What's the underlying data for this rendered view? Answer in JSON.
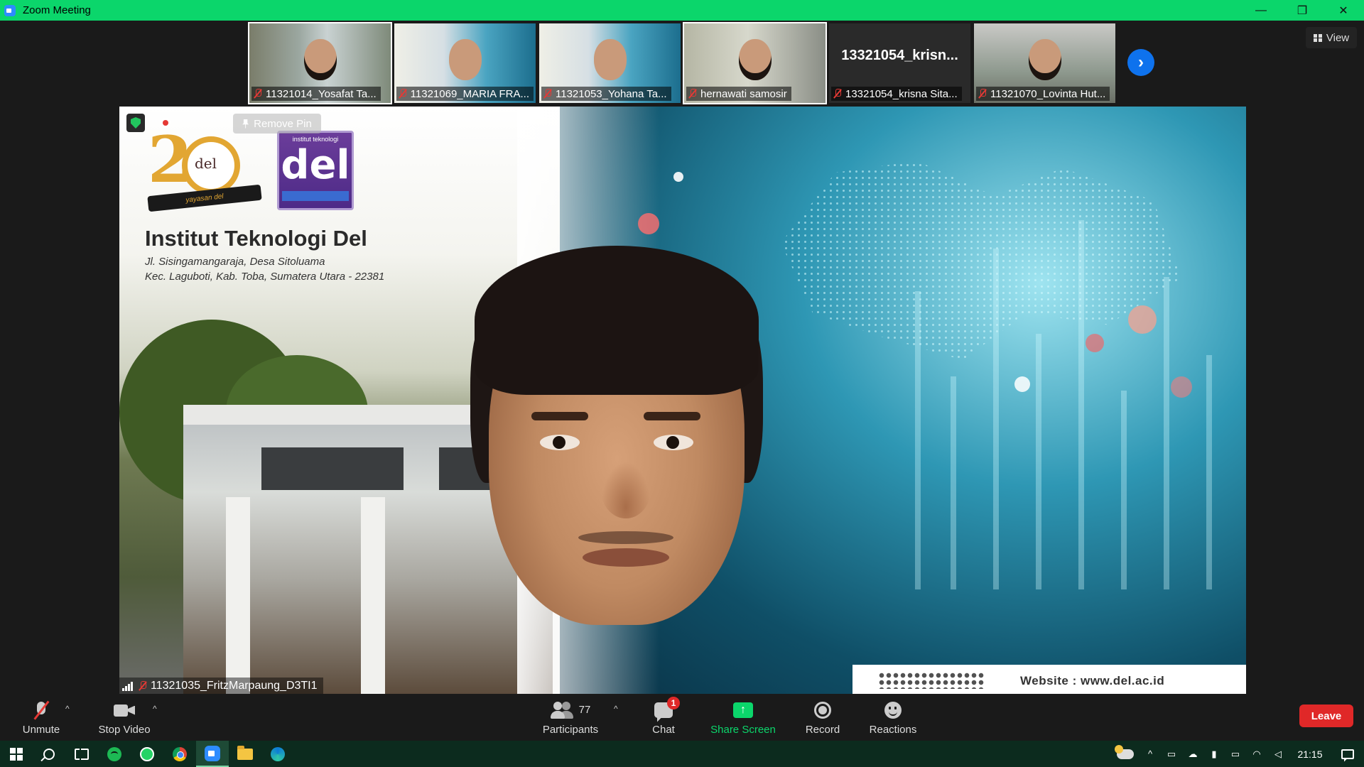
{
  "window": {
    "title": "Zoom Meeting",
    "controls": [
      "—",
      "❐",
      "✕"
    ]
  },
  "thumbnails": [
    {
      "name": "11321014_Yosafat Ta...",
      "muted": true,
      "video": true
    },
    {
      "name": "11321069_MARIA FRA...",
      "muted": true,
      "video": true
    },
    {
      "name": "11321053_Yohana Ta...",
      "muted": true,
      "video": true
    },
    {
      "name": "hernawati samosir",
      "muted": true,
      "video": true
    },
    {
      "name": "13321054_krisna Sita...",
      "display_name": "13321054_krisn...",
      "muted": true,
      "video": false
    },
    {
      "name": "11321070_Lovinta Hut...",
      "muted": true,
      "video": true
    }
  ],
  "view_button": {
    "label": "View"
  },
  "main_video": {
    "participant_name": "11321035_FritzMarpaung_D3TI1",
    "remove_pin_label": "Remove Pin",
    "background": {
      "institution": "Institut Teknologi Del",
      "address_line1": "Jl. Sisingamangaraja, Desa Sitoluama",
      "address_line2": "Kec. Laguboti, Kab. Toba, Sumatera Utara - 22381",
      "logo_20_text": "del",
      "logo_20_ribbon": "yayasan del",
      "logo_del_text": "del",
      "logo_del_top": "institut teknologi",
      "website": "Website    : www.del.ac.id"
    }
  },
  "controls": {
    "unmute": "Unmute",
    "stop_video": "Stop Video",
    "participants": "Participants",
    "participants_count": "77",
    "chat": "Chat",
    "chat_badge": "1",
    "share_screen": "Share Screen",
    "record": "Record",
    "reactions": "Reactions",
    "leave": "Leave",
    "caret": "^",
    "share_arrow": "↑",
    "next_arrow": "›"
  },
  "taskbar": {
    "time": "21:15",
    "apps": [
      "windows-start",
      "search",
      "task-view",
      "spotify",
      "whatsapp",
      "chrome",
      "zoom",
      "file-explorer",
      "edge"
    ]
  },
  "colors": {
    "titlebar": "#0bd66b",
    "leave": "#e02828",
    "share_screen": "#0bd66b",
    "accent_blue": "#0e72ed",
    "taskbar": "#0c2b1e"
  }
}
